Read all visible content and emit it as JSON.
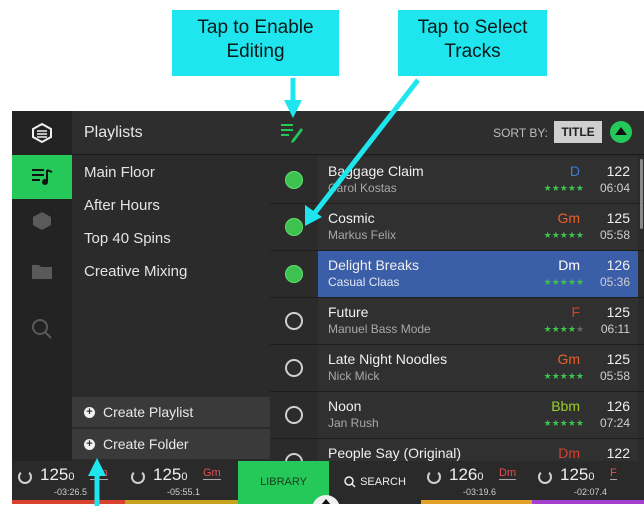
{
  "callouts": {
    "edit": "Tap to Enable Editing",
    "select": "Tap to Select Tracks"
  },
  "playlists": {
    "title": "Playlists",
    "items": [
      "Main Floor",
      "After Hours",
      "Top 40 Spins",
      "Creative Mixing"
    ],
    "create_playlist": "Create Playlist",
    "create_folder": "Create Folder"
  },
  "sort": {
    "label": "SORT BY:",
    "value": "TITLE"
  },
  "tracks": [
    {
      "title": "Baggage Claim",
      "artist": "Carol Kostas",
      "key": "D",
      "key_color": "#3a7bd5",
      "bpm": "122",
      "time": "06:04",
      "rating": 5,
      "selected": true
    },
    {
      "title": "Cosmic",
      "artist": "Markus Felix",
      "key": "Gm",
      "key_color": "#e8622c",
      "bpm": "125",
      "time": "05:58",
      "rating": 5,
      "selected": true
    },
    {
      "title": "Delight Breaks",
      "artist": "Casual Claas",
      "key": "Dm",
      "key_color": "#ffffff",
      "bpm": "126",
      "time": "05:36",
      "rating": 5,
      "selected": true,
      "highlighted": true
    },
    {
      "title": "Future",
      "artist": "Manuel Bass Mode",
      "key": "F",
      "key_color": "#d8412e",
      "bpm": "125",
      "time": "06:11",
      "rating": 4,
      "selected": false
    },
    {
      "title": "Late Night Noodles",
      "artist": "Nick Mick",
      "key": "Gm",
      "key_color": "#e8622c",
      "bpm": "125",
      "time": "05:58",
      "rating": 5,
      "selected": false
    },
    {
      "title": "Noon",
      "artist": "Jan Rush",
      "key": "Bbm",
      "key_color": "#9ccf2a",
      "bpm": "126",
      "time": "07:24",
      "rating": 5,
      "selected": false
    },
    {
      "title": "People Say (Original)",
      "artist": "",
      "key": "Dm",
      "key_color": "#d8412e",
      "bpm": "122",
      "time": "",
      "rating": 0,
      "selected": false
    }
  ],
  "decks": [
    {
      "bpm": "125",
      "bpm_dec": "0",
      "key": "Gm",
      "remaining": "-03:26.5",
      "strip_color": "#d8412e"
    },
    {
      "bpm": "125",
      "bpm_dec": "0",
      "key": "Gm",
      "remaining": "-05:55.1",
      "strip_color": "#c9a21d"
    },
    {
      "bpm": "126",
      "bpm_dec": "0",
      "key": "Dm",
      "remaining": "-03:19.6",
      "strip_color": "#e3a12a"
    },
    {
      "bpm": "125",
      "bpm_dec": "0",
      "key": "F",
      "remaining": "-02:07.4",
      "strip_color": "#a53fd0"
    }
  ],
  "library_label": "LIBRARY",
  "search_label": "SEARCH",
  "colors": {
    "accent": "#24c95a",
    "callout": "#1fe6ee",
    "highlight": "#3b5ea8"
  }
}
